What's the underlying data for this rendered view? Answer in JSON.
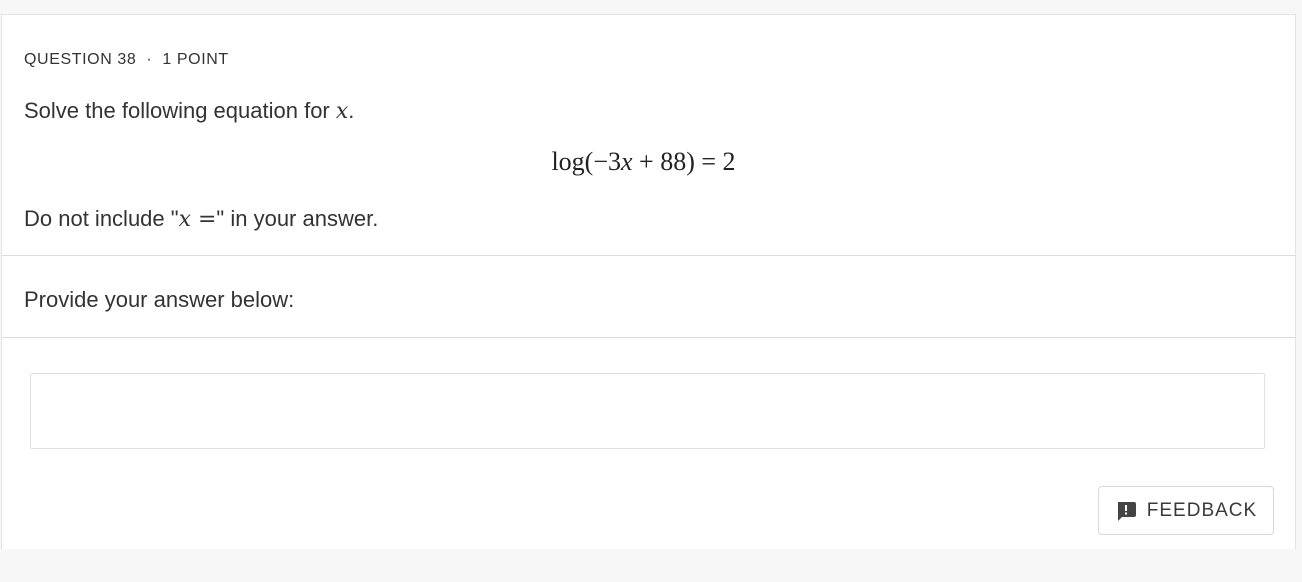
{
  "question": {
    "number_label": "QUESTION 38",
    "separator": "·",
    "points_label": "1 POINT",
    "text_before": "Solve the following equation for ",
    "variable": "x",
    "text_after": ".",
    "equation": {
      "prefix": "log(−3",
      "variable": "x",
      "suffix": " + 88) = 2"
    },
    "note_before": "Do not include \"",
    "note_math": "x =",
    "note_after": "\" in your answer."
  },
  "answer": {
    "prompt": "Provide your answer below:",
    "value": "",
    "placeholder": ""
  },
  "feedback": {
    "label": "FEEDBACK",
    "icon": "feedback-alert-icon"
  },
  "colors": {
    "text": "#333333",
    "border": "#dcdcdc",
    "background": "#f7f7f7",
    "card": "#ffffff"
  }
}
